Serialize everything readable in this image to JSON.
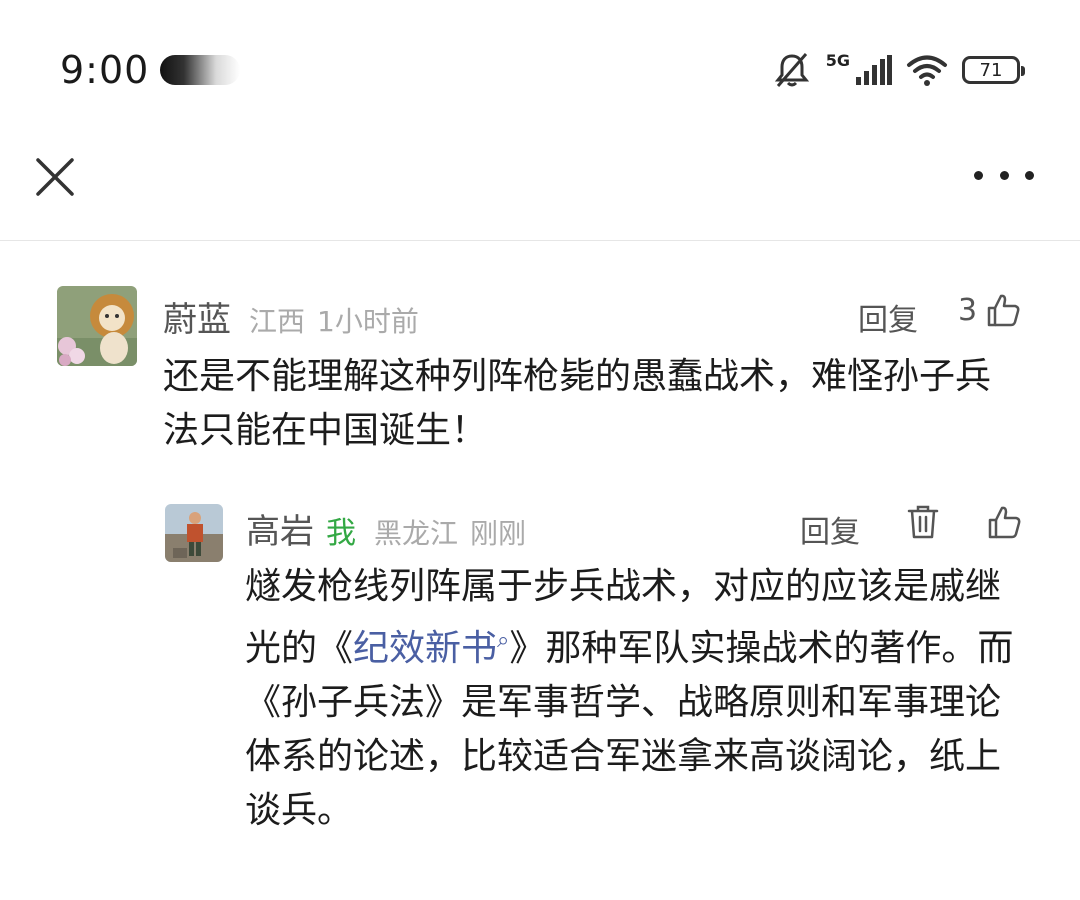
{
  "status_bar": {
    "time": "9:00",
    "network": "5G",
    "battery": "71"
  },
  "nav": {
    "close_icon": "close-icon",
    "more_icon": "more-icon"
  },
  "comment": {
    "username": "蔚蓝",
    "location": "江西",
    "time_ago": "1小时前",
    "reply_label": "回复",
    "like_count": "3",
    "text": "还是不能理解这种列阵枪毙的愚蠢战术，难怪孙子兵法只能在中国诞生！"
  },
  "reply": {
    "username": "高岩",
    "me_tag": "我",
    "location": "黑龙江",
    "time_ago": "刚刚",
    "reply_label": "回复",
    "text_before_link": "燧发枪线列阵属于步兵战术，对应的应该是戚继光的《",
    "link_text": "纪效新书",
    "text_after_link": "》那种军队实操战术的著作。而《孙子兵法》是军事哲学、战略原则和军事理论体系的论述，比较适合军迷拿来高谈阔论，纸上谈兵。"
  },
  "colors": {
    "accent_link": "#4a5fa3",
    "me_tag": "#33a844",
    "meta_gray": "#aaaaaa"
  }
}
